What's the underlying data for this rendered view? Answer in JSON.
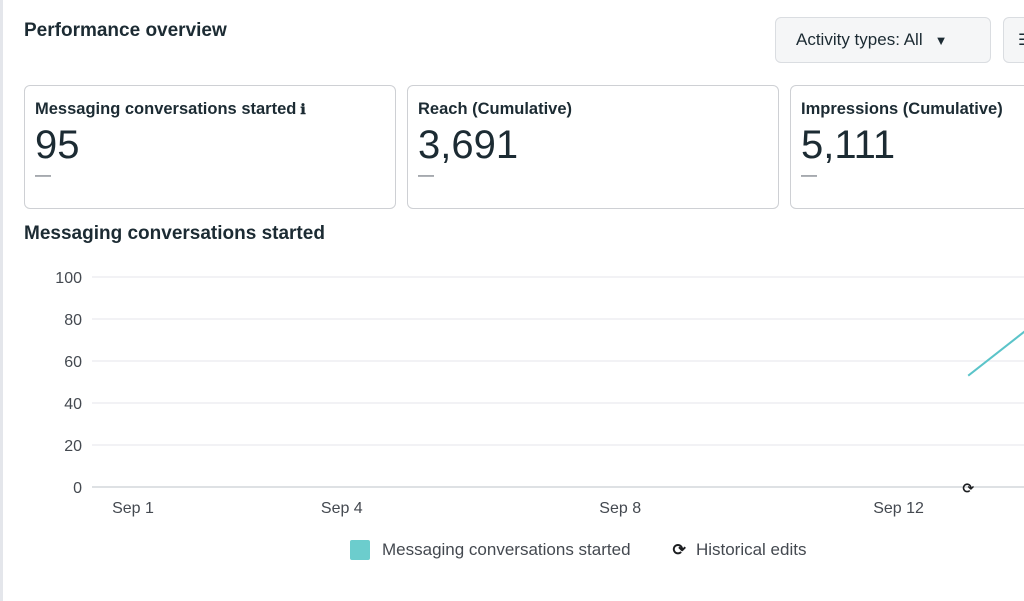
{
  "header": {
    "title": "Performance overview",
    "activity_dropdown": "Activity types: All",
    "dropdown_caret": "▼",
    "filter_icon": "☰"
  },
  "cards": [
    {
      "label": "Messaging conversations started",
      "value": "95",
      "delta": "—",
      "has_info": true
    },
    {
      "label": "Reach (Cumulative)",
      "value": "3,691",
      "delta": "—"
    },
    {
      "label": "Impressions (Cumulative)",
      "value": "5,111",
      "delta": "—"
    }
  ],
  "info_icon": "ℹ",
  "chart_section": {
    "title": "Messaging conversations started"
  },
  "chart_data": {
    "type": "line",
    "x_ticks": [
      "Sep 1",
      "Sep 4",
      "Sep 8",
      "Sep 12"
    ],
    "y_ticks": [
      0,
      20,
      40,
      60,
      80,
      100
    ],
    "ylim": [
      0,
      100
    ],
    "series": [
      {
        "name": "Messaging conversations started",
        "color": "#5bc4c9",
        "points": [
          {
            "x": "Sep 13",
            "y": 53
          },
          {
            "x": "Sep 14",
            "y": 79
          }
        ]
      }
    ],
    "historical_edit_marker": {
      "x": "Sep 13"
    },
    "grid": true
  },
  "legend": {
    "series_label": "Messaging conversations started",
    "edits_label": "Historical edits",
    "edits_icon": "⟳"
  }
}
